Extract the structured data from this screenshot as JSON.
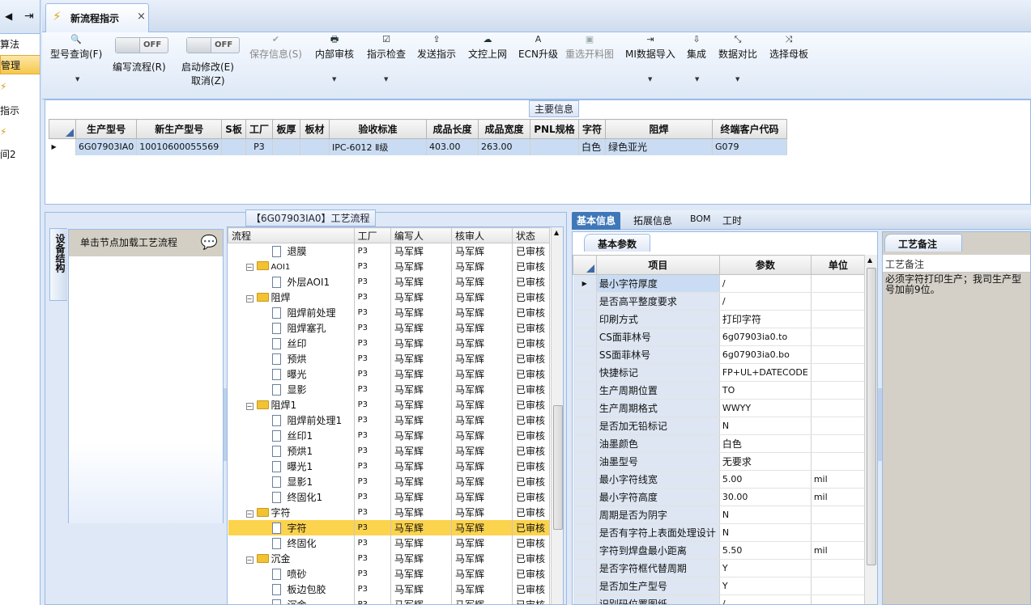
{
  "leftnav": {
    "items": [
      "算法",
      "管理",
      "指示",
      "间2"
    ]
  },
  "tab": {
    "title": "新流程指示",
    "close": "×"
  },
  "toolbar": {
    "buttons": [
      {
        "label": "型号查询(F)",
        "icon": "search-icon",
        "glyph": "🔍"
      },
      {
        "label": "编写流程(R)",
        "icon": "toggle"
      },
      {
        "label": "启动修改(E)",
        "icon": "toggle"
      },
      {
        "label": "保存信息(S)",
        "icon": "check-icon",
        "glyph": "✔"
      },
      {
        "label": "内部审核",
        "icon": "printer-icon",
        "glyph": "🖶"
      },
      {
        "label": "指示检查",
        "icon": "checkbox-icon",
        "glyph": "☑"
      },
      {
        "label": "发送指示",
        "icon": "upload-icon",
        "glyph": "⇪"
      },
      {
        "label": "文控上网",
        "icon": "cloud-icon",
        "glyph": "☁"
      },
      {
        "label": "ECN升级",
        "icon": "ecn-icon",
        "glyph": "A"
      },
      {
        "label": "重选开料图",
        "icon": "image-icon",
        "glyph": "▣"
      },
      {
        "label": "MI数据导入",
        "icon": "import-icon",
        "glyph": "⇥"
      },
      {
        "label": "集成",
        "icon": "download-icon",
        "glyph": "⇩"
      },
      {
        "label": "数据对比",
        "icon": "compare-icon",
        "glyph": "⤡"
      },
      {
        "label": "选择母板",
        "icon": "shuffle-icon",
        "glyph": "⤨"
      }
    ],
    "toggle_off": "OFF",
    "cancel_label": "取消(Z)"
  },
  "main_info": {
    "title": "主要信息",
    "columns": [
      "生产型号",
      "新生产型号",
      "S板",
      "工厂",
      "板厚",
      "板材",
      "验收标准",
      "成品长度",
      "成品宽度",
      "PNL规格",
      "字符",
      "阻焊",
      "终端客户代码"
    ],
    "row": [
      "6G07903IA0",
      "10010600055569",
      "",
      "P3",
      "",
      "",
      "IPC-6012 Ⅱ级",
      "403.00",
      "263.00",
      "",
      "白色",
      "绿色亚光",
      "G079"
    ]
  },
  "process": {
    "title": "【6G07903IA0】工艺流程",
    "side_tab": "设备结构",
    "load_hint": "单击节点加载工艺流程",
    "columns": [
      "流程",
      "工厂",
      "编写人",
      "核审人",
      "状态"
    ],
    "rows": [
      {
        "name": "退膜",
        "type": "leaf",
        "factory": "P3",
        "writer": "马军辉",
        "reviewer": "马军辉",
        "status": "已审核"
      },
      {
        "name": "AOI1",
        "type": "folder",
        "factory": "P3",
        "writer": "马军辉",
        "reviewer": "马军辉",
        "status": "已审核"
      },
      {
        "name": "外层AOI1",
        "type": "leaf",
        "factory": "P3",
        "writer": "马军辉",
        "reviewer": "马军辉",
        "status": "已审核"
      },
      {
        "name": "阻焊",
        "type": "folder",
        "factory": "P3",
        "writer": "马军辉",
        "reviewer": "马军辉",
        "status": "已审核"
      },
      {
        "name": "阻焊前处理",
        "type": "leaf",
        "factory": "P3",
        "writer": "马军辉",
        "reviewer": "马军辉",
        "status": "已审核"
      },
      {
        "name": "阻焊塞孔",
        "type": "leaf",
        "factory": "P3",
        "writer": "马军辉",
        "reviewer": "马军辉",
        "status": "已审核"
      },
      {
        "name": "丝印",
        "type": "leaf",
        "factory": "P3",
        "writer": "马军辉",
        "reviewer": "马军辉",
        "status": "已审核"
      },
      {
        "name": "预烘",
        "type": "leaf",
        "factory": "P3",
        "writer": "马军辉",
        "reviewer": "马军辉",
        "status": "已审核"
      },
      {
        "name": "曝光",
        "type": "leaf",
        "factory": "P3",
        "writer": "马军辉",
        "reviewer": "马军辉",
        "status": "已审核"
      },
      {
        "name": "显影",
        "type": "leaf",
        "factory": "P3",
        "writer": "马军辉",
        "reviewer": "马军辉",
        "status": "已审核"
      },
      {
        "name": "阻焊1",
        "type": "folder",
        "factory": "P3",
        "writer": "马军辉",
        "reviewer": "马军辉",
        "status": "已审核"
      },
      {
        "name": "阻焊前处理1",
        "type": "leaf",
        "factory": "P3",
        "writer": "马军辉",
        "reviewer": "马军辉",
        "status": "已审核"
      },
      {
        "name": "丝印1",
        "type": "leaf",
        "factory": "P3",
        "writer": "马军辉",
        "reviewer": "马军辉",
        "status": "已审核"
      },
      {
        "name": "预烘1",
        "type": "leaf",
        "factory": "P3",
        "writer": "马军辉",
        "reviewer": "马军辉",
        "status": "已审核"
      },
      {
        "name": "曝光1",
        "type": "leaf",
        "factory": "P3",
        "writer": "马军辉",
        "reviewer": "马军辉",
        "status": "已审核"
      },
      {
        "name": "显影1",
        "type": "leaf",
        "factory": "P3",
        "writer": "马军辉",
        "reviewer": "马军辉",
        "status": "已审核"
      },
      {
        "name": "终固化1",
        "type": "leaf",
        "factory": "P3",
        "writer": "马军辉",
        "reviewer": "马军辉",
        "status": "已审核"
      },
      {
        "name": "字符",
        "type": "folder",
        "factory": "P3",
        "writer": "马军辉",
        "reviewer": "马军辉",
        "status": "已审核"
      },
      {
        "name": "字符",
        "type": "leaf",
        "factory": "P3",
        "writer": "马军辉",
        "reviewer": "马军辉",
        "status": "已审核",
        "selected": true
      },
      {
        "name": "终固化",
        "type": "leaf",
        "factory": "P3",
        "writer": "马军辉",
        "reviewer": "马军辉",
        "status": "已审核"
      },
      {
        "name": "沉金",
        "type": "folder",
        "factory": "P3",
        "writer": "马军辉",
        "reviewer": "马军辉",
        "status": "已审核"
      },
      {
        "name": "喷砂",
        "type": "leaf",
        "factory": "P3",
        "writer": "马军辉",
        "reviewer": "马军辉",
        "status": "已审核"
      },
      {
        "name": "板边包胶",
        "type": "leaf",
        "factory": "P3",
        "writer": "马军辉",
        "reviewer": "马军辉",
        "status": "已审核"
      },
      {
        "name": "沉金",
        "type": "leaf",
        "factory": "P3",
        "writer": "马军辉",
        "reviewer": "马军辉",
        "status": "已审核"
      }
    ]
  },
  "right_tabs": [
    "基本信息",
    "拓展信息",
    "BOM",
    "工时"
  ],
  "basic_params": {
    "title": "基本参数",
    "columns": [
      "项目",
      "参数",
      "单位"
    ],
    "rows": [
      {
        "item": "最小字符厚度",
        "value": "/",
        "unit": ""
      },
      {
        "item": "是否高平整度要求",
        "value": "/",
        "unit": ""
      },
      {
        "item": "印刷方式",
        "value": "打印字符",
        "unit": ""
      },
      {
        "item": "CS面菲林号",
        "value": "6g07903ia0.to",
        "unit": ""
      },
      {
        "item": "SS面菲林号",
        "value": "6g07903ia0.bo",
        "unit": ""
      },
      {
        "item": "快捷标记",
        "value": "FP+UL+DATECODE",
        "unit": ""
      },
      {
        "item": "生产周期位置",
        "value": "TO",
        "unit": ""
      },
      {
        "item": "生产周期格式",
        "value": "WWYY",
        "unit": ""
      },
      {
        "item": "是否加无铅标记",
        "value": "N",
        "unit": ""
      },
      {
        "item": "油墨颜色",
        "value": "白色",
        "unit": ""
      },
      {
        "item": "油墨型号",
        "value": "无要求",
        "unit": ""
      },
      {
        "item": "最小字符线宽",
        "value": "5.00",
        "unit": "mil"
      },
      {
        "item": "最小字符高度",
        "value": "30.00",
        "unit": "mil"
      },
      {
        "item": "周期是否为阴字",
        "value": "N",
        "unit": ""
      },
      {
        "item": "是否有字符上表面处理设计",
        "value": "N",
        "unit": ""
      },
      {
        "item": "字符到焊盘最小距离",
        "value": "5.50",
        "unit": "mil"
      },
      {
        "item": "是否字符框代替周期",
        "value": "Y",
        "unit": ""
      },
      {
        "item": "是否加生产型号",
        "value": "Y",
        "unit": ""
      },
      {
        "item": "识别码位置图纸",
        "value": "/",
        "unit": ""
      }
    ]
  },
  "remark": {
    "title": "工艺备注",
    "header": "工艺备注",
    "text": "必须字符打印生产；我司生产型号加前9位。"
  }
}
